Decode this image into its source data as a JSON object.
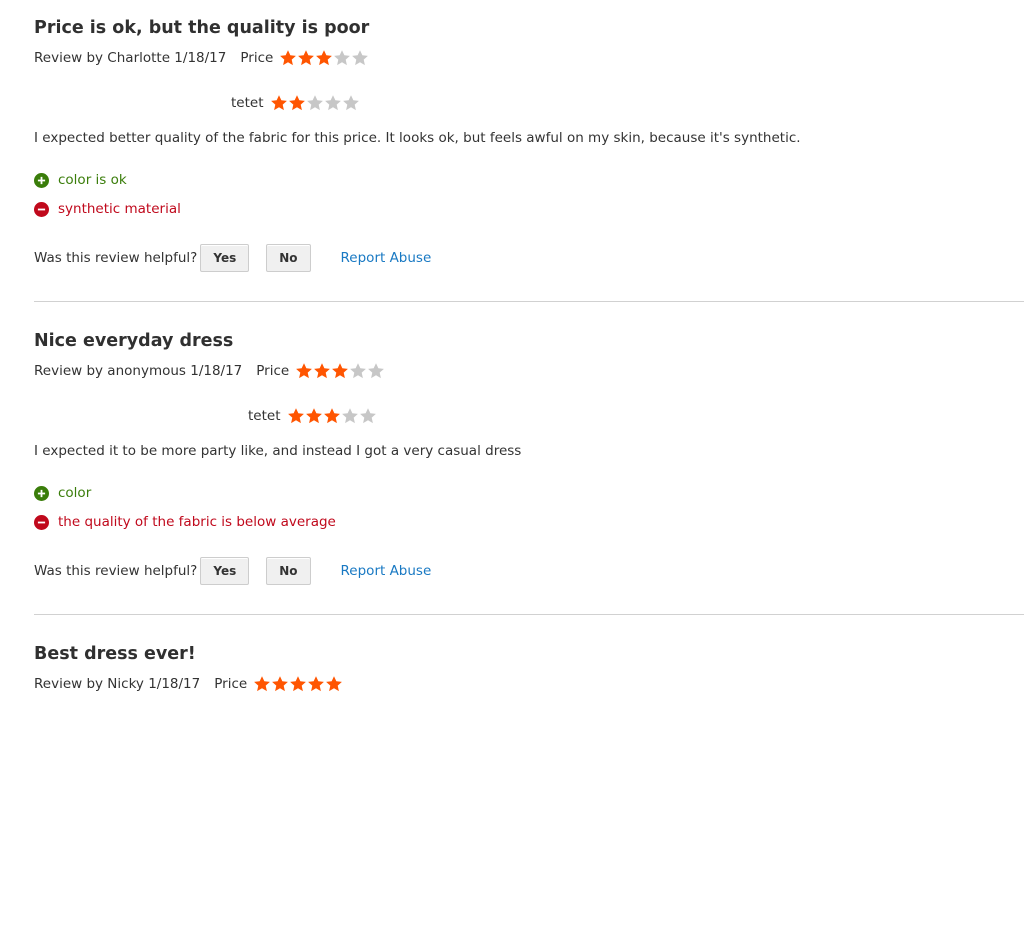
{
  "colors": {
    "star_filled": "#ff5501",
    "star_empty": "#c7c7c7",
    "pro": "#3a7d0a",
    "con": "#c0091c",
    "link": "#1979c3"
  },
  "helpful_prompt": "Was this review helpful?",
  "yes_label": "Yes",
  "no_label": "No",
  "report_label": "Report Abuse",
  "reviews": [
    {
      "title": "Price is ok, but the quality is poor",
      "byline": "Review by Charlotte 1/18/17",
      "ratings": [
        {
          "label": "Price",
          "value": 3,
          "max": 5
        },
        {
          "label": "tetet",
          "value": 2,
          "max": 5
        }
      ],
      "text": "I expected better quality of the fabric for this price. It looks ok, but feels awful on my skin, because it's synthetic.",
      "pro": "color is ok",
      "con": "synthetic material"
    },
    {
      "title": "Nice everyday dress",
      "byline": "Review by anonymous 1/18/17",
      "ratings": [
        {
          "label": "Price",
          "value": 3,
          "max": 5
        },
        {
          "label": "tetet",
          "value": 3,
          "max": 5
        }
      ],
      "text": "I expected it to be more party like, and instead I got a very casual dress",
      "pro": "color",
      "con": "the quality of the fabric is below average"
    },
    {
      "title": "Best dress ever!",
      "byline": "Review by Nicky 1/18/17",
      "ratings": [
        {
          "label": "Price",
          "value": 5,
          "max": 5
        }
      ]
    }
  ]
}
